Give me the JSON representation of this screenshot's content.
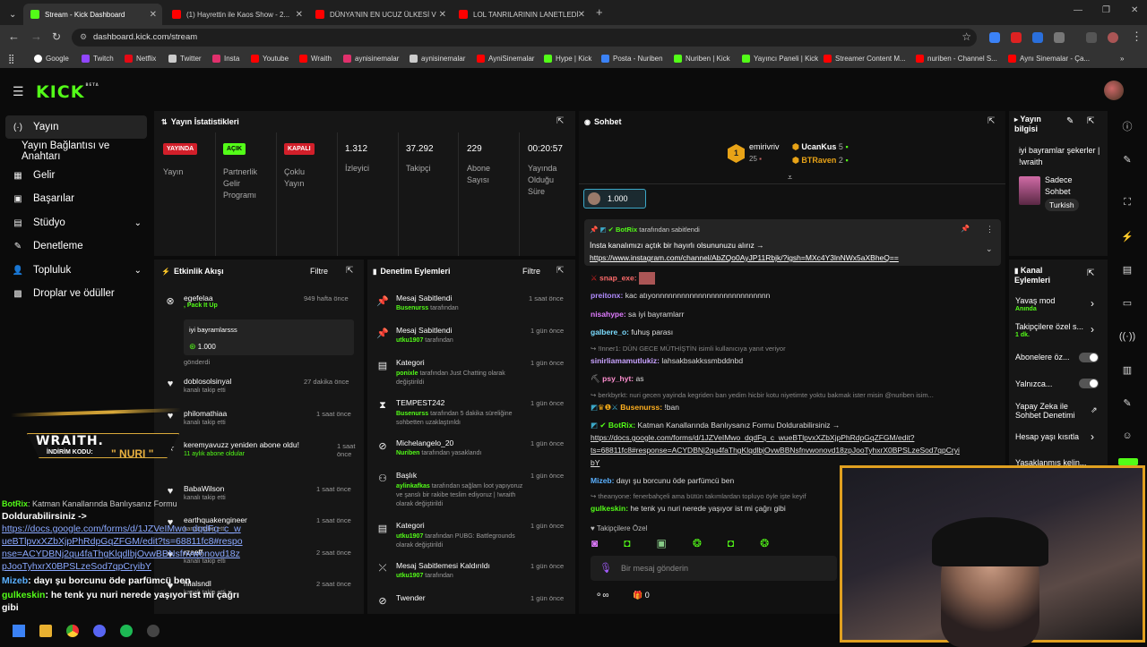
{
  "browser": {
    "tabs": [
      {
        "title": "Stream - Kick Dashboard",
        "active": true
      },
      {
        "title": "(1) Hayrettin ile Kaos Show - 2..."
      },
      {
        "title": "DÜNYA'NIN EN UCUZ ÜLKESİ V"
      },
      {
        "title": "LOL TANRILARININ LANETLEDİ"
      }
    ],
    "new_tab": "+",
    "url": "dashboard.kick.com/stream",
    "bookmarks": [
      "Google",
      "Twitch",
      "Netflix",
      "Twitter",
      "Insta",
      "Youtube",
      "Wraith",
      "aynisinemalar",
      "aynisinemalar",
      "AyniSinemalar",
      "Hype | Kick",
      "Posta - Nuriben",
      "Nuriben | Kick",
      "Yayıncı Paneli | Kick",
      "Streamer Content M...",
      "nuriben - Channel S...",
      "Aynı Sinemalar - Ça..."
    ]
  },
  "kick": {
    "logo": "KICK",
    "beta": "BETA"
  },
  "sidebar": {
    "items": [
      {
        "label": "Yayın",
        "icon": "(·)"
      },
      {
        "label": "Yayın Bağlantısı ve Anahtarı",
        "icon": ""
      },
      {
        "label": "Gelir",
        "icon": "▦"
      },
      {
        "label": "Başarılar",
        "icon": "▣"
      },
      {
        "label": "Stüdyo",
        "icon": "▤"
      },
      {
        "label": "Denetleme",
        "icon": "✎"
      },
      {
        "label": "Topluluk",
        "icon": "👤"
      },
      {
        "label": "Droplar ve ödüller",
        "icon": "▩"
      }
    ]
  },
  "stats": {
    "title": "Yayın İstatistikleri",
    "live_badge": "YAYINDA",
    "live_label": "Yayın",
    "partner_badge": "AÇIK",
    "partner_label": "Partnerlik Gelir Programı",
    "multi_badge": "KAPALI",
    "multi_label": "Çoklu Yayın",
    "viewers": "1.312",
    "viewers_label": "İzleyici",
    "followers": "37.292",
    "followers_label": "Takipçi",
    "subs": "229",
    "subs_label": "Abone Sayısı",
    "uptime": "00:20:57",
    "uptime_label": "Yayında Olduğu Süre"
  },
  "activity": {
    "title": "Etkinlik Akışı",
    "filter": "Filtre",
    "items": [
      {
        "user": "egefelaa",
        "detail": ", Pack It Up",
        "time": "949 hafta önce",
        "msg": "iyi bayramlarsss",
        "amount": "1.000",
        "sent": "gönderdi"
      },
      {
        "user": "doblosolsinyal",
        "detail": "kanalı takip etti",
        "time": "27 dakika önce"
      },
      {
        "user": "philomathiaa",
        "detail": "kanalı takip etti",
        "time": "1 saat önce"
      },
      {
        "user": "keremyavuzz yeniden abone oldu!",
        "detail": "11 aylık abone oldular",
        "time": "1 saat önce"
      },
      {
        "user": "BabaWilson",
        "detail": "kanalı takip etti",
        "time": "1 saat önce"
      },
      {
        "user": "earthquakengineer",
        "detail": "kanalı takip etti",
        "time": "1 saat önce"
      },
      {
        "user": "rzaeff",
        "detail": "kanalı takip etti",
        "time": "2 saat önce"
      },
      {
        "user": "hilalsndl",
        "detail": "kanalı takip etti",
        "time": "2 saat önce"
      }
    ]
  },
  "moderation": {
    "title": "Denetim Eylemleri",
    "filter": "Filtre",
    "items": [
      {
        "title": "Mesaj Sabitlendi",
        "user": "Busenurss",
        "text": " tarafından",
        "time": "1 saat önce"
      },
      {
        "title": "Mesaj Sabitlendi",
        "user": "utku1907",
        "text": " tarafından",
        "time": "1 gün önce"
      },
      {
        "title": "Kategori",
        "user": "ponixle",
        "text": " tarafından Just Chatting olarak değiştirildi",
        "time": "1 gün önce"
      },
      {
        "title": "TEMPEST242",
        "user": "Busenurss",
        "text": " tarafından 5 dakika süreliğine sohbetten uzaklaştırıldı",
        "time": "1 gün önce"
      },
      {
        "title": "Michelangelo_20",
        "user": "Nuriben",
        "text": " tarafından yasaklandı",
        "time": "1 gün önce"
      },
      {
        "title": "Başlık",
        "user": "aylinkafkas",
        "text": " tarafından sağlam loot yapıyoruz ve şanslı bir rakibe teslim ediyoruz | !wraith olarak değiştirildi",
        "time": "1 gün önce"
      },
      {
        "title": "Kategori",
        "user": "utku1907",
        "text": " tarafından PUBG: Battlegrounds olarak değiştirildi",
        "time": "1 gün önce"
      },
      {
        "title": "Mesaj Sabitlemesi Kaldırıldı",
        "user": "utku1907",
        "text": " tarafından",
        "time": "1 gün önce"
      },
      {
        "title": "Twender",
        "user": "",
        "text": "",
        "time": "1 gün önce"
      }
    ]
  },
  "chat": {
    "title": "Sohbet",
    "top": [
      {
        "name": "emirivriv",
        "value": "25",
        "rank": "1"
      },
      {
        "name": "UcanKus",
        "value": "5"
      },
      {
        "name": "BTRaven",
        "value": "2"
      }
    ],
    "kicks": "1.000",
    "pinned_by": "BotRix",
    "pinned_suffix": " tarafından sabitlendi",
    "pinned_text": "İnsta kanalımızı açtık bir hayırlı olsununuzu alırız →",
    "pinned_link": "https://www.instagram.com/channel/AbZQo0AyJP11Rbjk/?igsh=MXc4Y3lnNWx5aXBheQ==",
    "messages": [
      {
        "user": "snap_exe:",
        "text": "",
        "color": "#ff6b6b"
      },
      {
        "user": "preitonx:",
        "text": " kac atıyonnnnnnnnnnnnnnnnnnnnnnnnnnn",
        "color": "#b18cff"
      },
      {
        "user": "nisahype:",
        "text": " sa iyi bayramlarr",
        "color": "#e07bff"
      },
      {
        "user": "galbere_o:",
        "text": " fuhuş parası",
        "color": "#7bdcff"
      },
      {
        "user": "",
        "text": "↪ !Inner1: DÜN GECE MÜTHİŞTİN isimli kullanıcıya yanıt veriyor",
        "color": "#888"
      },
      {
        "user": "sinirliamamutlukiz:",
        "text": " lahsakbsakkssmbddnbd",
        "color": "#c8a2ff"
      },
      {
        "user": "psy_hyt:",
        "text": " as",
        "color": "#ff8fd0"
      },
      {
        "user": "",
        "text": "↪ berkbyrkt: nuri gecen yayinda kegriden ban yedim hicbir kotu niyetimte yoktu bakmak ister misin @nuriben isim...",
        "color": "#888"
      },
      {
        "user": "Busenurss:",
        "text": " !ban",
        "color": "#ffb020"
      },
      {
        "user": "BotRix:",
        "text": " Katman Kanallarında Banlıysanız Formu Doldurabilirsiniz →",
        "color": "#53fc18"
      },
      {
        "user": "",
        "text": "https://docs.google.com/forms/d/1JZVeIMwo_dqdFq_c_wueBTlpvxXZbXjpPhRdpGqZFGM/edit?",
        "color": "#e0e0e0"
      },
      {
        "user": "",
        "text": "ts=68811fc8#response=ACYDBNj2qu4faThgKlqdlbjOvwBBNsfnvwonovd18zpJooTyhxrX0BPSLzeSod7qpCryi",
        "color": "#e0e0e0"
      },
      {
        "user": "",
        "text": "bY",
        "color": "#e0e0e0"
      },
      {
        "user": "Mizeb:",
        "text": " dayı şu borcunu öde parfümcü ben",
        "color": "#5ab0ff"
      },
      {
        "user": "",
        "text": "↪ theanyone: fenerbahçeli ama bütün takımlardan topluyo öyle işte keyif",
        "color": "#888"
      },
      {
        "user": "gulkeskin:",
        "text": " he tenk yu nuri nerede yaşıyor ist mi çağrı gibi",
        "color": "#53fc18"
      }
    ],
    "followers_only": "Takipçilere Özel",
    "placeholder": "Bir mesaj gönderin",
    "gifts": "0"
  },
  "stream_info": {
    "title": "Yayın bilgisi",
    "stream_title": "iyi bayramlar şekerler | !wraith",
    "category": "Sadece Sohbet",
    "language": "Turkish"
  },
  "channel_actions": {
    "title": "Kanal Eylemleri",
    "items": [
      {
        "label": "Yavaş mod",
        "sub": "Anında"
      },
      {
        "label": "Takipçilere özel s...",
        "sub": "1 dk."
      },
      {
        "label": "Abonelere öz..."
      },
      {
        "label": "Yalnızca..."
      },
      {
        "label": "Yapay Zeka ile Sohbet Denetimi"
      },
      {
        "label": "Hesap yaşı kısıtla"
      },
      {
        "label": "Yasaklanmış kelin..."
      }
    ]
  },
  "overlay": {
    "brand": "WRAITH.",
    "code_label": "İNDİRİM KODU:",
    "code": "\" NURI \"",
    "lines": [
      {
        "user": "BotRix",
        "text": ": Katman Kanallarında Banlıysanız Formu"
      },
      {
        "user": "",
        "text": "Doldurabilirsiniz ->"
      },
      {
        "user": "",
        "text": "https://docs.google.com/forms/d/1JZVeIMwo_dqdFq_c_wueBTlpvxXZbXjpPhRdpGqZFGM/edit?ts=68811fc8#response=ACYDBNj2qu4faThgKlqdlbjOvwBBNsfnvwonovd18zpJooTyhxrX0BPSLzeSod7qpCryibY"
      },
      {
        "user": "Mizeb",
        "text": ": dayı şu borcunu öde parfümcü ben"
      },
      {
        "user": "gulkeskin",
        "text": ": he tenk yu nuri nerede yaşıyor ist mi çağrı gibi"
      }
    ]
  }
}
